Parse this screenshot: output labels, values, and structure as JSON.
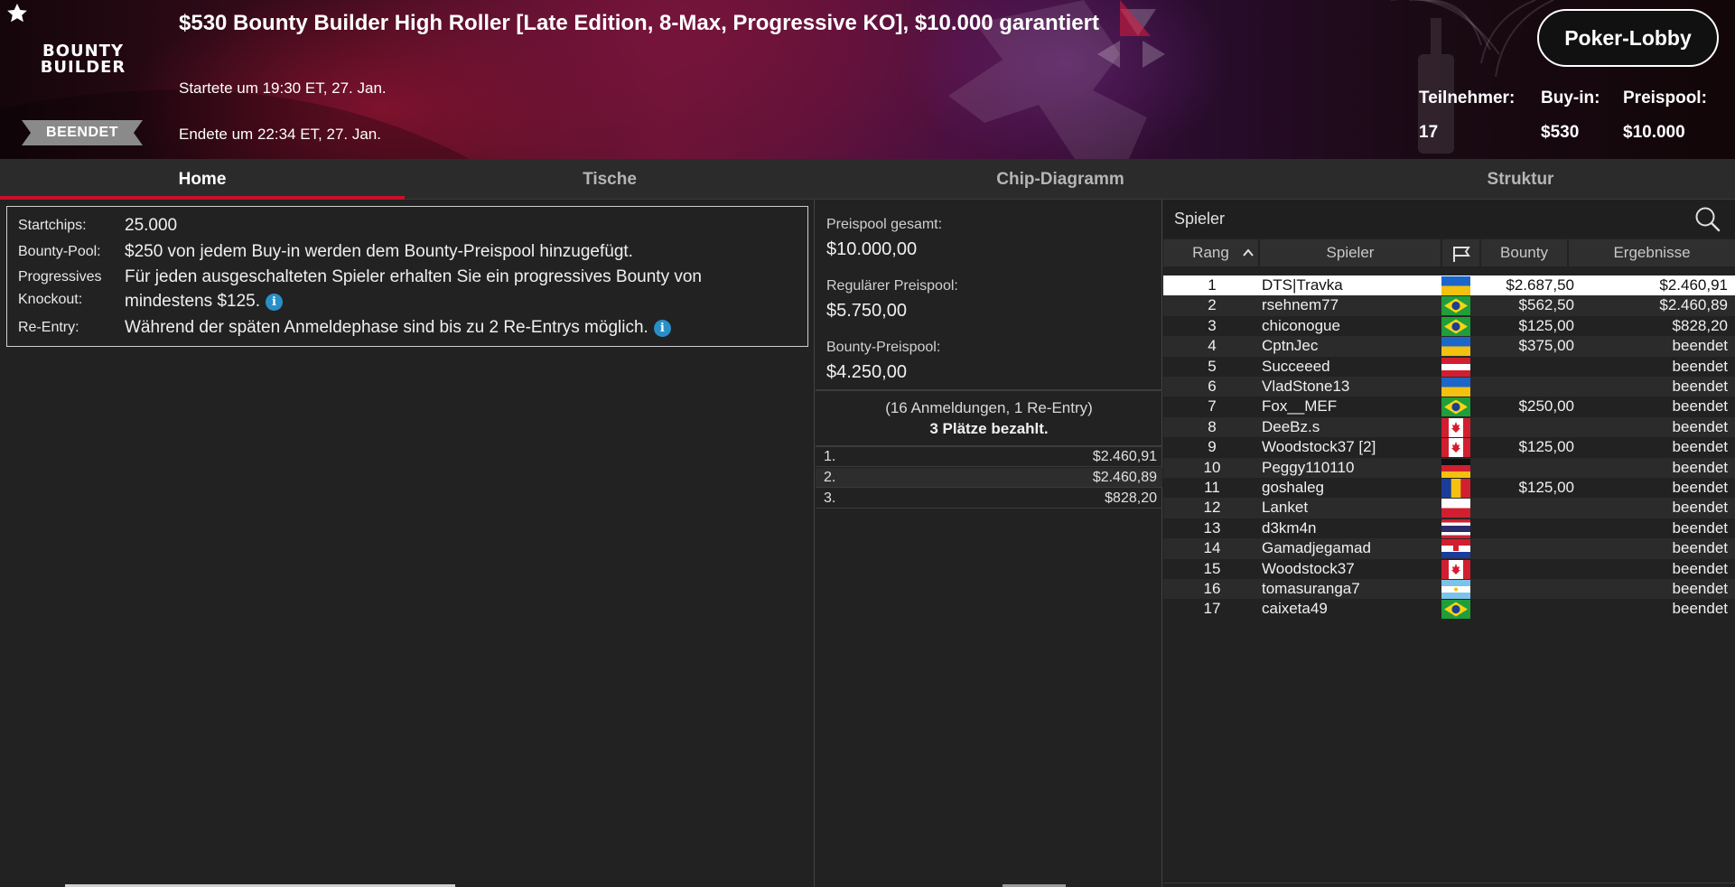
{
  "header": {
    "title": "$530 Bounty Builder High Roller [Late Edition, 8-Max, Progressive KO], $10.000 garantiert",
    "logo_line1": "BOUNTY",
    "logo_line2": "BUILDER",
    "status": "BEENDET",
    "start_time": "Startete um 19:30 ET, 27. Jan.",
    "end_time": "Endete um 22:34 ET, 27. Jan.",
    "lobby_button": "Poker-Lobby",
    "stats": [
      {
        "label": "Teilnehmer:",
        "value": "17"
      },
      {
        "label": "Buy-in:",
        "value": "$530"
      },
      {
        "label": "Preispool:",
        "value": "$10.000"
      }
    ]
  },
  "tabs": [
    {
      "label": "Home",
      "active": true
    },
    {
      "label": "Tische",
      "active": false
    },
    {
      "label": "Chip-Diagramm",
      "active": false
    },
    {
      "label": "Struktur",
      "active": false
    }
  ],
  "info": {
    "startchips_label": "Startchips:",
    "startchips_value": "25.000",
    "bounty_label": "Bounty-Pool:",
    "bounty_value": "$250 von jedem Buy-in werden dem Bounty-Preispool hinzugefügt.",
    "pko_label_1": "Progressives",
    "pko_label_2": "Knockout:",
    "pko_value_1": "Für jeden ausgeschalteten Spieler erhalten Sie ein progressives Bounty von",
    "pko_value_2": "mindestens $125.",
    "reentry_label": "Re-Entry:",
    "reentry_value": "Während der späten Anmeldephase sind bis zu 2 Re-Entrys möglich.",
    "info_glyph": "i"
  },
  "prize": {
    "total_label": "Preispool gesamt:",
    "total_value": "$10.000,00",
    "regular_label": "Regulärer Preispool:",
    "regular_value": "$5.750,00",
    "bounty_label": "Bounty-Preispool:",
    "bounty_value": "$4.250,00",
    "entries": "(16 Anmeldungen, 1 Re-Entry)",
    "paid": "3 Plätze bezahlt.",
    "payouts": [
      {
        "place": "1.",
        "amount": "$2.460,91"
      },
      {
        "place": "2.",
        "amount": "$2.460,89"
      },
      {
        "place": "3.",
        "amount": "$828,20"
      }
    ]
  },
  "players": {
    "search_placeholder": "Spieler",
    "columns": {
      "rank": "Rang",
      "player": "Spieler",
      "bounty": "Bounty",
      "result": "Ergebnisse"
    },
    "rows": [
      {
        "rank": "1",
        "name": "DTS|Travka",
        "flag": "ukraine",
        "bounty": "$2.687,50",
        "result": "$2.460,91"
      },
      {
        "rank": "2",
        "name": "rsehnem77",
        "flag": "brazil",
        "bounty": "$562,50",
        "result": "$2.460,89"
      },
      {
        "rank": "3",
        "name": "chiconogue",
        "flag": "brazil",
        "bounty": "$125,00",
        "result": "$828,20"
      },
      {
        "rank": "4",
        "name": "CptnJec",
        "flag": "ukraine",
        "bounty": "$375,00",
        "result": "beendet"
      },
      {
        "rank": "5",
        "name": "Succeeed",
        "flag": "austria",
        "bounty": "",
        "result": "beendet"
      },
      {
        "rank": "6",
        "name": "VladStone13",
        "flag": "ukraine",
        "bounty": "",
        "result": "beendet"
      },
      {
        "rank": "7",
        "name": "Fox__MEF",
        "flag": "brazil",
        "bounty": "$250,00",
        "result": "beendet"
      },
      {
        "rank": "8",
        "name": "DeeBz.s",
        "flag": "canada",
        "bounty": "",
        "result": "beendet"
      },
      {
        "rank": "9",
        "name": "Woodstock37 [2]",
        "flag": "canada",
        "bounty": "$125,00",
        "result": "beendet"
      },
      {
        "rank": "10",
        "name": "Peggy110110",
        "flag": "germany",
        "bounty": "",
        "result": "beendet"
      },
      {
        "rank": "11",
        "name": "goshaleg",
        "flag": "romania",
        "bounty": "$125,00",
        "result": "beendet"
      },
      {
        "rank": "12",
        "name": "Lanket",
        "flag": "poland",
        "bounty": "",
        "result": "beendet"
      },
      {
        "rank": "13",
        "name": "d3km4n",
        "flag": "thailand",
        "bounty": "",
        "result": "beendet"
      },
      {
        "rank": "14",
        "name": "Gamadjegamad",
        "flag": "croatia",
        "bounty": "",
        "result": "beendet"
      },
      {
        "rank": "15",
        "name": "Woodstock37",
        "flag": "canada",
        "bounty": "",
        "result": "beendet"
      },
      {
        "rank": "16",
        "name": "tomasuranga7",
        "flag": "argentina",
        "bounty": "",
        "result": "beendet"
      },
      {
        "rank": "17",
        "name": "caixeta49",
        "flag": "brazil",
        "bounty": "",
        "result": "beendet"
      }
    ]
  },
  "colors": {
    "accent": "#c8102e",
    "info_icon": "#2a8fc7",
    "background": "#222222"
  }
}
